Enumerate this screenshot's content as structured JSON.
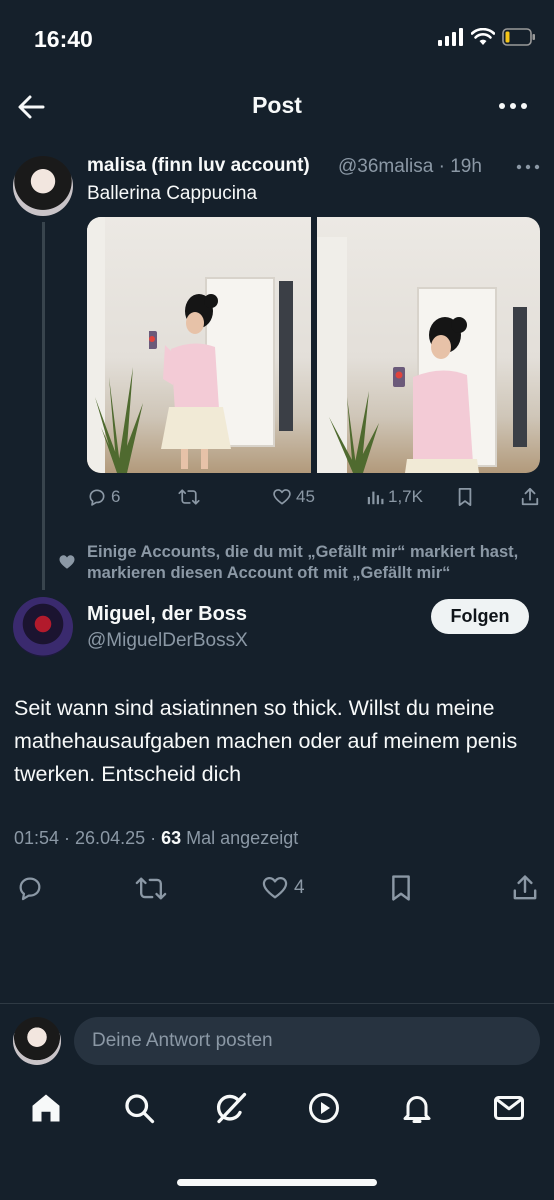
{
  "status_bar": {
    "time": "16:40"
  },
  "header": {
    "title": "Post"
  },
  "parent_tweet": {
    "name": "malisa (finn luv account)",
    "handle_time": "@36malisa · 19h",
    "text": "Ballerina Cappucina",
    "replies": "6",
    "retweets": "",
    "likes": "45",
    "views": "1,7K"
  },
  "liked_note": "Einige Accounts, die du mit „Gefällt mir“ markiert hast, markieren diesen Account oft mit „Gefällt mir“",
  "main_tweet": {
    "name": "Miguel, der Boss",
    "handle": "@MiguelDerBossX",
    "follow_label": "Folgen",
    "text": "Seit wann sind asiatinnen so thick. Willst du meine mathehausaufgaben machen oder auf meinem penis twerken. Entscheid dich",
    "time_date": "01:54 · 26.04.25 · ",
    "view_count": "63",
    "view_label": " Mal angezeigt",
    "likes": "4"
  },
  "reply": {
    "placeholder": "Deine Antwort posten"
  },
  "colors": {
    "background": "#15202b",
    "muted": "#8b98a5",
    "divider": "#2f3a44",
    "input_bg": "#273340"
  },
  "icons": [
    "back-arrow-icon",
    "more-icon",
    "reply-icon",
    "retweet-icon",
    "heart-icon",
    "views-icon",
    "bookmark-icon",
    "share-icon",
    "home-icon",
    "search-icon",
    "grok-icon",
    "video-icon",
    "bell-icon",
    "mail-icon"
  ]
}
